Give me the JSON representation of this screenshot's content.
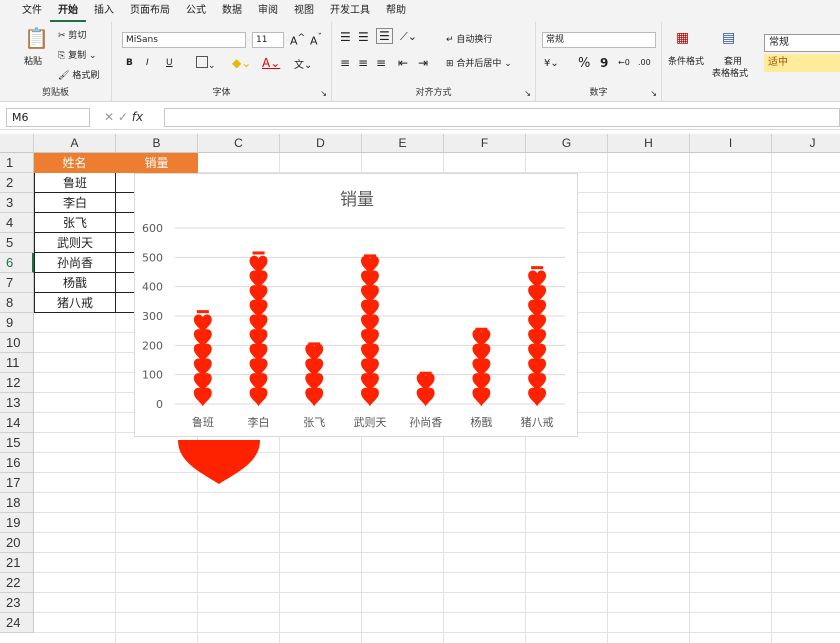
{
  "menu": [
    "文件",
    "开始",
    "插入",
    "页面布局",
    "公式",
    "数据",
    "审阅",
    "视图",
    "开发工具",
    "帮助"
  ],
  "ribbon": {
    "clipboard": {
      "paste": "粘贴",
      "cut": "剪切",
      "copy": "复制",
      "format_painter": "格式刷",
      "label": "剪贴板"
    },
    "font": {
      "name": "MiSans",
      "size": "11",
      "bold": "B",
      "italic": "I",
      "underline": "U",
      "label": "字体"
    },
    "align": {
      "wrap": "自动换行",
      "merge": "合并后居中",
      "label": "对齐方式"
    },
    "number": {
      "format": "常规",
      "percent": "%",
      "comma": "9",
      "label": "数字"
    },
    "styles": {
      "cond": "条件格式",
      "table1": "套用",
      "table2": "表格格式",
      "normal": "常规",
      "neutral": "适中"
    }
  },
  "namebox": "M6",
  "fx": "fx",
  "columns": [
    "A",
    "B",
    "C",
    "D",
    "E",
    "F",
    "G",
    "H",
    "I",
    "J"
  ],
  "rows": [
    "1",
    "2",
    "3",
    "4",
    "5",
    "6",
    "7",
    "8",
    "9",
    "10",
    "11",
    "12",
    "13",
    "14",
    "15",
    "16",
    "17",
    "18",
    "19",
    "20",
    "21",
    "22",
    "23",
    "24"
  ],
  "table": {
    "header_name": "姓名",
    "header_sales": "销量",
    "names": [
      "鲁班",
      "李白",
      "张飞",
      "武则天",
      "孙尚香",
      "杨戬",
      "猪八戒"
    ]
  },
  "colors": {
    "header": "#ed7d31",
    "heart": "#ff2200",
    "selected_row": "#1e7145"
  },
  "chart_data": {
    "type": "bar",
    "title": "销量",
    "categories": [
      "鲁班",
      "李白",
      "张飞",
      "武则天",
      "孙尚香",
      "杨戬",
      "猪八戒"
    ],
    "values": [
      320,
      520,
      210,
      510,
      110,
      260,
      470
    ],
    "ylim": [
      0,
      600
    ],
    "yticks": [
      "0",
      "100",
      "200",
      "300",
      "400",
      "500",
      "600"
    ],
    "marker": "heart-icon",
    "grid": true
  }
}
